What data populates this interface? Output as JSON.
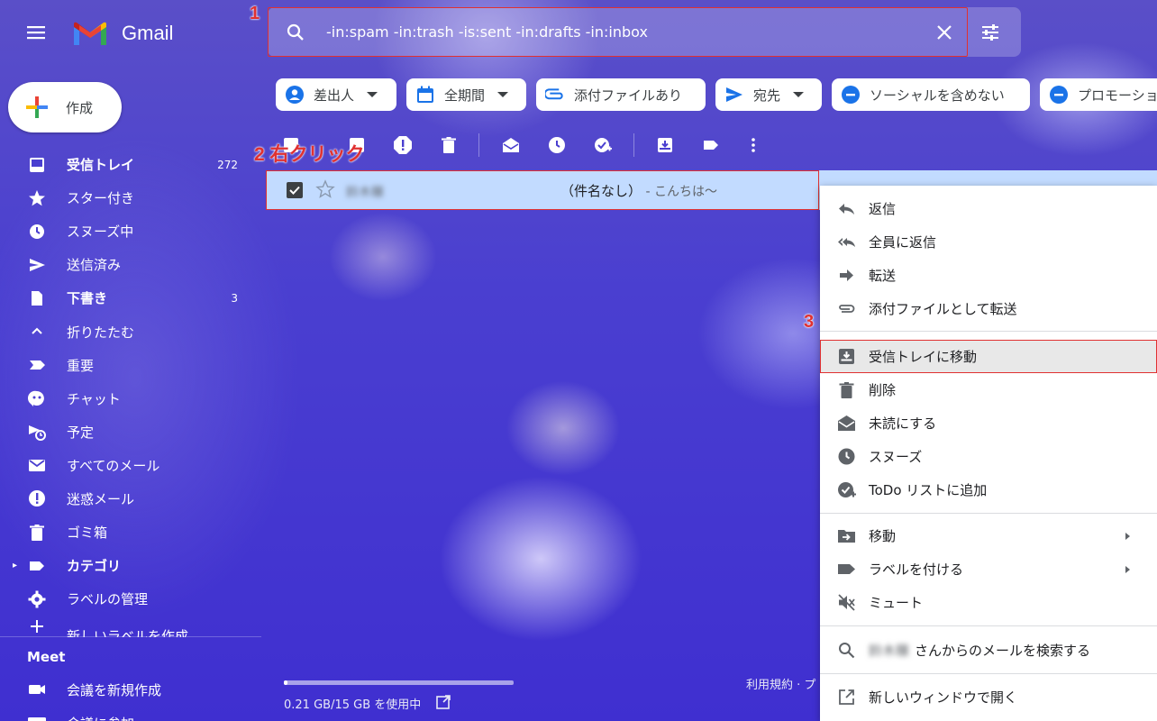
{
  "app": {
    "name": "Gmail"
  },
  "search": {
    "query": "-in:spam -in:trash -is:sent -in:drafts -in:inbox"
  },
  "annotations": {
    "step1": "1",
    "step2": "2 右クリック",
    "step3": "3"
  },
  "compose": {
    "label": "作成"
  },
  "sidebar": {
    "items": [
      {
        "label": "受信トレイ",
        "count": "272",
        "icon": "inbox-icon",
        "bold": true
      },
      {
        "label": "スター付き",
        "icon": "star-icon"
      },
      {
        "label": "スヌーズ中",
        "icon": "clock-icon"
      },
      {
        "label": "送信済み",
        "icon": "send-icon"
      },
      {
        "label": "下書き",
        "count": "3",
        "icon": "draft-icon",
        "bold": true
      },
      {
        "label": "折りたたむ",
        "icon": "chevron-up-icon"
      },
      {
        "label": "重要",
        "icon": "important-icon"
      },
      {
        "label": "チャット",
        "icon": "chat-icon"
      },
      {
        "label": "予定",
        "icon": "scheduled-icon"
      },
      {
        "label": "すべてのメール",
        "icon": "mail-icon"
      },
      {
        "label": "迷惑メール",
        "icon": "spam-icon"
      },
      {
        "label": "ゴミ箱",
        "icon": "trash-icon"
      },
      {
        "label": "カテゴリ",
        "icon": "label-icon",
        "bold": true
      },
      {
        "label": "ラベルの管理",
        "icon": "gear-icon"
      },
      {
        "label": "新しいラベルを作成",
        "icon": "plus-icon"
      }
    ],
    "meet": {
      "title": "Meet",
      "items": [
        {
          "label": "会議を新規作成",
          "icon": "video-icon"
        },
        {
          "label": "会議に参加",
          "icon": "keyboard-icon"
        }
      ]
    }
  },
  "chips": [
    {
      "label": "差出人",
      "icon": "person-icon",
      "dropdown": true
    },
    {
      "label": "全期間",
      "icon": "calendar-icon",
      "dropdown": true
    },
    {
      "label": "添付ファイルあり",
      "icon": "attachment-icon",
      "dropdown": false
    },
    {
      "label": "宛先",
      "icon": "send-icon",
      "dropdown": true
    },
    {
      "label": "ソーシャルを含めない",
      "icon": "minus-circle-icon",
      "dropdown": false
    },
    {
      "label": "プロモーション",
      "icon": "minus-circle-icon",
      "dropdown": false
    }
  ],
  "email": {
    "sender": "鈴木穣",
    "subject": "（件名なし）",
    "snippet": " - こんちは〜"
  },
  "storage": {
    "text": "0.21 GB/15 GB を使用中",
    "fraction": 0.014
  },
  "footer": {
    "links": "利用規約 · プ"
  },
  "context_menu": {
    "items": [
      {
        "label": "返信",
        "icon": "reply-icon"
      },
      {
        "label": "全員に返信",
        "icon": "reply-all-icon"
      },
      {
        "label": "転送",
        "icon": "forward-icon"
      },
      {
        "label": "添付ファイルとして転送",
        "icon": "attachment-icon"
      },
      {
        "label": "受信トレイに移動",
        "icon": "move-to-inbox-icon"
      },
      {
        "label": "削除",
        "icon": "trash-icon"
      },
      {
        "label": "未読にする",
        "icon": "mark-unread-icon"
      },
      {
        "label": "スヌーズ",
        "icon": "clock-icon"
      },
      {
        "label": "ToDo リストに追加",
        "icon": "add-task-icon"
      },
      {
        "label": "移動",
        "icon": "move-to-icon",
        "submenu": true
      },
      {
        "label": "ラベルを付ける",
        "icon": "label-icon",
        "submenu": true
      },
      {
        "label": "ミュート",
        "icon": "mute-icon"
      },
      {
        "label": "さんからのメールを検索する",
        "icon": "search-icon",
        "name": "鈴木穣"
      },
      {
        "label": "新しいウィンドウで開く",
        "icon": "open-in-new-icon"
      }
    ]
  },
  "colors": {
    "highlight_border": "#e03131",
    "selected_row": "#c2dbff",
    "background": "#4a3fd0"
  }
}
